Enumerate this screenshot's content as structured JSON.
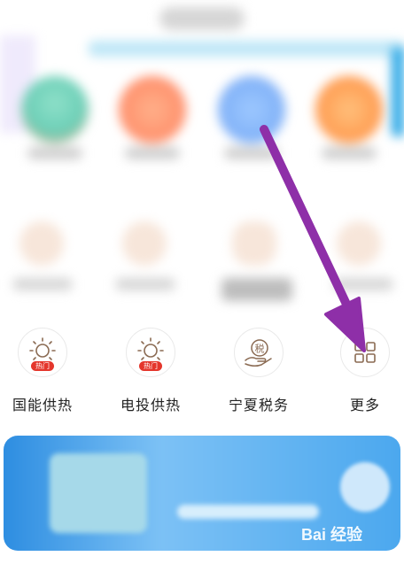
{
  "services": [
    {
      "label": "国能供热",
      "icon": "sun-icon",
      "badge": "热门"
    },
    {
      "label": "电投供热",
      "icon": "sun-icon",
      "badge": "热门"
    },
    {
      "label": "宁夏税务",
      "icon": "tax-hand-icon",
      "glyph": "税"
    },
    {
      "label": "更多",
      "icon": "grid-icon"
    }
  ],
  "watermark": "Bai 经验",
  "colors": {
    "hot": "#e4362c",
    "annotation": "#8e2fa8",
    "icon_stroke": "#8a6a52"
  }
}
